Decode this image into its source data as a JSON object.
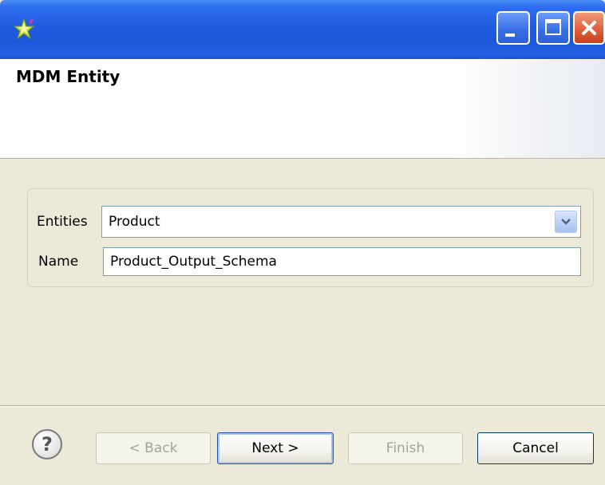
{
  "window": {
    "icon": "talend-star-icon",
    "controls": [
      "minimize-icon",
      "maximize-icon",
      "close-icon"
    ]
  },
  "banner": {
    "title": "MDM Entity"
  },
  "form": {
    "entities_label": "Entities",
    "entities_value": "Product",
    "name_label": "Name",
    "name_value": "Product_Output_Schema"
  },
  "footer": {
    "help_icon": "help-icon",
    "back_label": "< Back",
    "next_label": "Next >",
    "finish_label": "Finish",
    "cancel_label": "Cancel"
  },
  "colors": {
    "titlebar": "#1f5ce0",
    "close_button": "#e0603a",
    "dialog_bg": "#ece9d8"
  }
}
